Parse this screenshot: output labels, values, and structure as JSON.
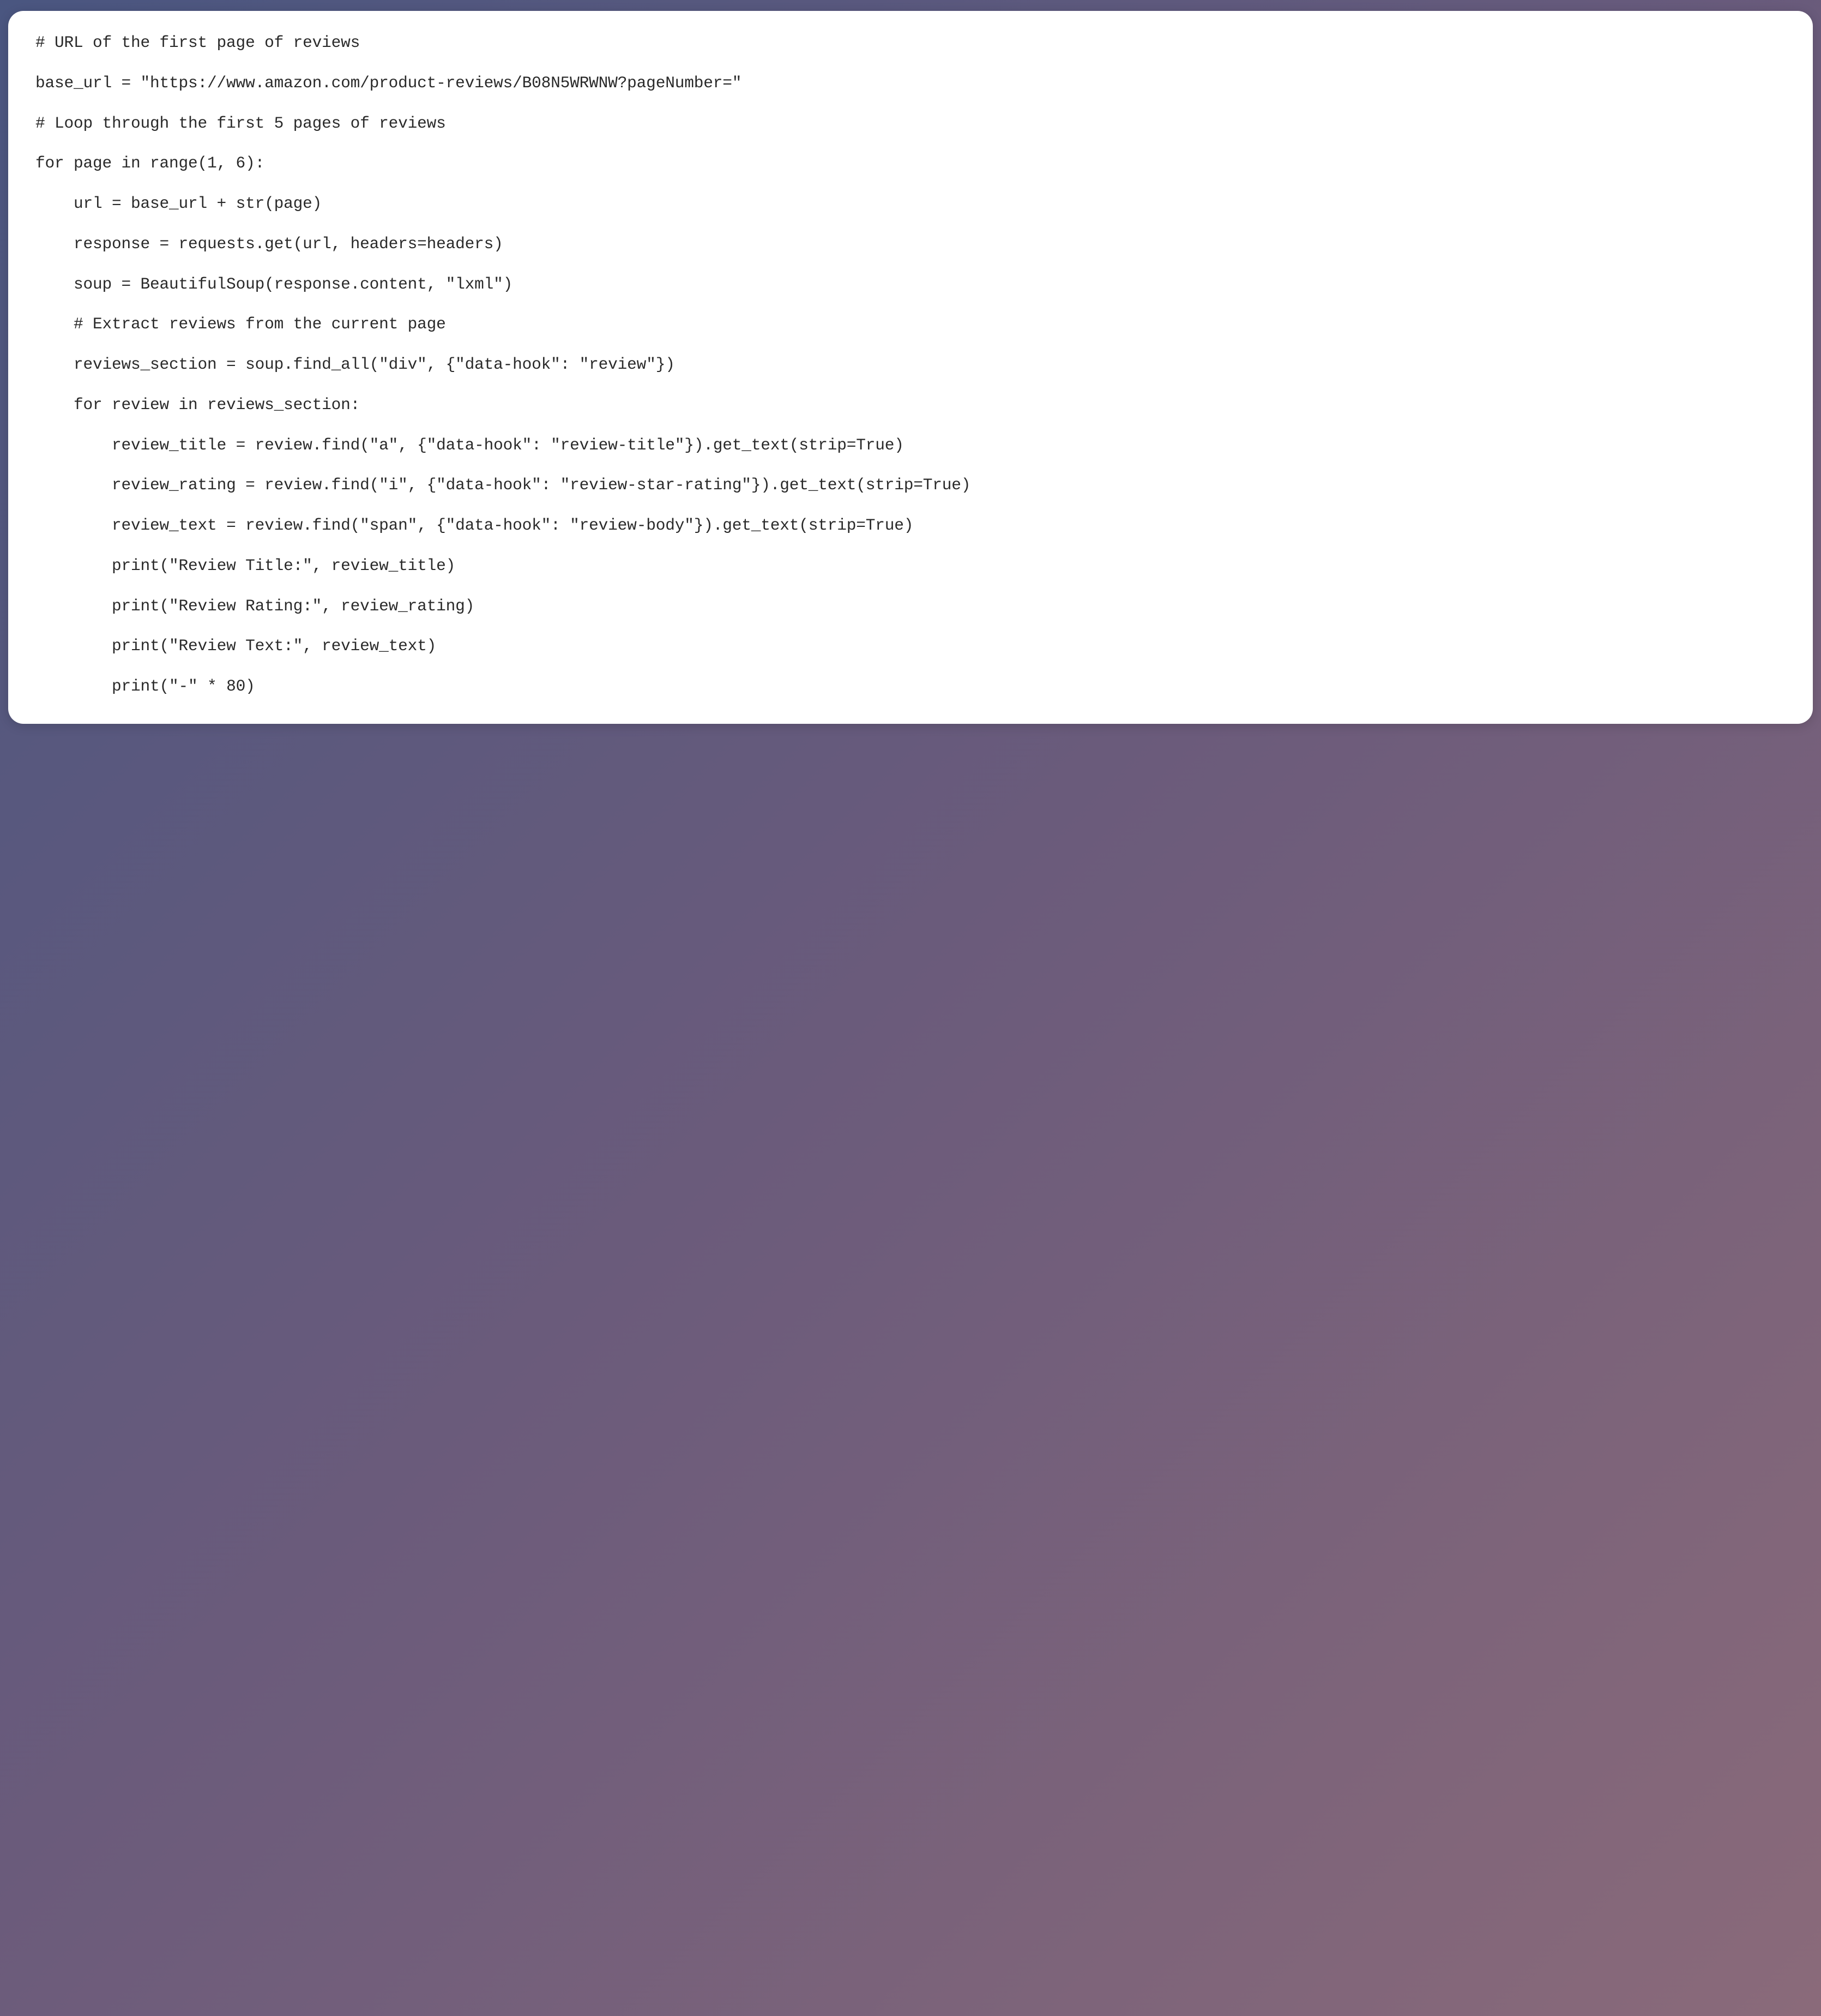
{
  "code": {
    "lines": [
      "# URL of the first page of reviews",
      "",
      "base_url = \"https://www.amazon.com/product-reviews/B08N5WRWNW?pageNumber=\"",
      "",
      "# Loop through the first 5 pages of reviews",
      "",
      "for page in range(1, 6):",
      "",
      "    url = base_url + str(page)",
      "",
      "    response = requests.get(url, headers=headers)",
      "",
      "    soup = BeautifulSoup(response.content, \"lxml\")",
      "",
      "    # Extract reviews from the current page",
      "",
      "    reviews_section = soup.find_all(\"div\", {\"data-hook\": \"review\"})",
      "",
      "    for review in reviews_section:",
      "",
      "        review_title = review.find(\"a\", {\"data-hook\": \"review-title\"}).get_text(strip=True)",
      "",
      "        review_rating = review.find(\"i\", {\"data-hook\": \"review-star-rating\"}).get_text(strip=True)",
      "",
      "        review_text = review.find(\"span\", {\"data-hook\": \"review-body\"}).get_text(strip=True)",
      "",
      "        print(\"Review Title:\", review_title)",
      "",
      "        print(\"Review Rating:\", review_rating)",
      "",
      "        print(\"Review Text:\", review_text)",
      "",
      "        print(\"-\" * 80)"
    ]
  }
}
